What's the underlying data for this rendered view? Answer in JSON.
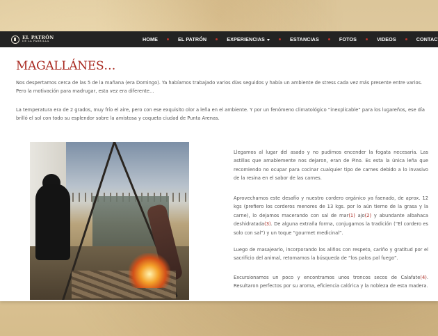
{
  "nav": {
    "logo_title": "EL PATRÓN",
    "logo_sub": "DE LA PARRILLA",
    "items": [
      "HOME",
      "EL PATRÓN",
      "EXPERIENCIAS",
      "ESTANCIAS",
      "FOTOS",
      "VIDEOS",
      "CONTACTO"
    ],
    "accent": "#b8332a"
  },
  "article": {
    "title": "MAGALLÁNES…",
    "intro1": "Nos despertamos cerca de las 5 de la mañana (era Domingo). Ya habíamos trabajado varios días seguidos y había un ambiente de stress cada vez más presente entre varios. Pero la motivación para madrugar, esta vez era diferente…",
    "intro2": "La temperatura era de 2 grados, muy frío el aire, pero con ese exquisito olor a leña en el ambiente. Y por un fenómeno climatológico “inexplicable” para los lugareños, ese día brilló el sol con todo su esplendor sobre la amistosa y coqueta ciudad de Punta Arenas.",
    "p1": "Llegamos al lugar del asado y no pudimos encender la fogata necesaria. Las astillas que amablemente nos dejaron, eran de Pino. Es esta la única leña que recomiendo no ocupar para cocinar cualquier tipo de carnes debido a lo invasivo de la resina en el sabor de las carnes.",
    "p2": {
      "t1": "Aprovechamos este desafío y nuestro cordero orgánico ya faenado, de aprox. 12 kgs (prefiero los corderos menores de 13 kgs. por lo aún tierno de la grasa y la carne), lo dejamos macerando con sal de mar",
      "r1": "(1)",
      "t2": " ajo",
      "r2": "(2)",
      "t3": " y abundante albahaca deshidratada",
      "r3": "(3)",
      "t4": ". De alguna extraña forma, conjugamos la tradición (“El cordero es solo con sal”) y un toque “gourmet medicinal”."
    },
    "p3": "Luego de masajearlo, incorporando los aliños con respeto, cariño y gratitud por el sacrificio del animal, retomamos la búsqueda de “los palos pal fuego”.",
    "p4": {
      "t1": "Excursionamos un poco y encontramos unos troncos secos de Calafate",
      "r1": "(4)",
      "t2": ". Resultaron perfectos por su aroma, eficiencia calórica y la nobleza de esta madera."
    },
    "title_color": "#a8281f"
  }
}
